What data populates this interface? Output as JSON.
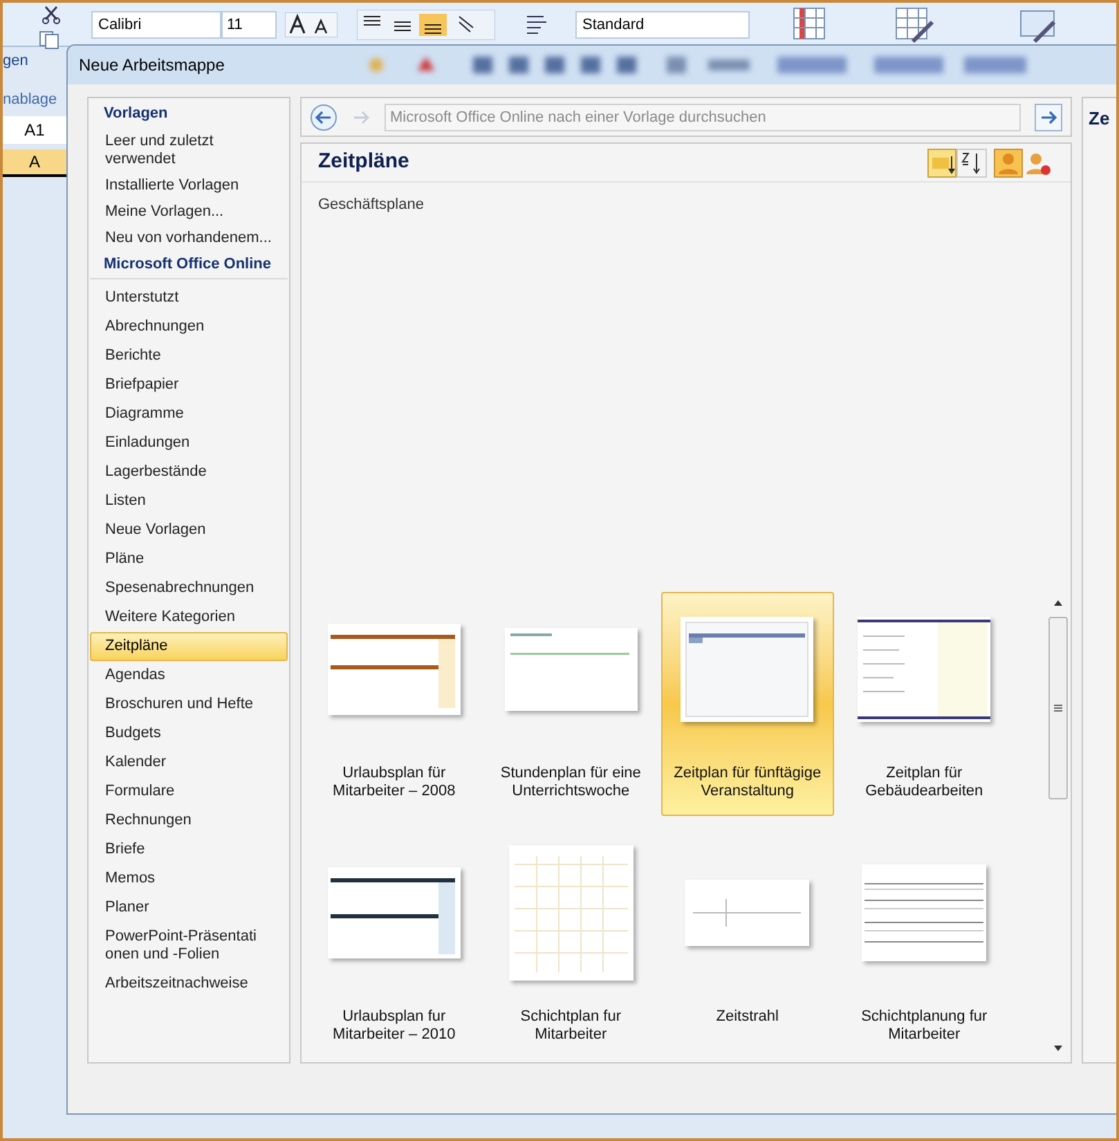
{
  "ribbon": {
    "left_labels": [
      "gen",
      "nablage"
    ],
    "name_box": "A1",
    "column_header": "A",
    "font": "Calibri",
    "font_size": "11",
    "number_format": "Standard"
  },
  "window": {
    "title": "Neue Arbeitsmappe"
  },
  "sidebar": {
    "sections": [
      {
        "heading": "Vorlagen",
        "items": [
          {
            "label": "Leer und zuletzt verwendet",
            "selected": false
          },
          {
            "label": "Installierte Vorlagen",
            "selected": false
          },
          {
            "label": "Meine Vorlagen...",
            "selected": false
          },
          {
            "label": "Neu von vorhandenem...",
            "selected": false
          }
        ]
      },
      {
        "heading": "Microsoft Office Online",
        "items": [
          {
            "label": "Unterstutzt",
            "selected": false
          },
          {
            "label": "Abrechnungen",
            "selected": false
          },
          {
            "label": "Berichte",
            "selected": false
          },
          {
            "label": "Briefpapier",
            "selected": false
          },
          {
            "label": "Diagramme",
            "selected": false
          },
          {
            "label": "Einladungen",
            "selected": false
          },
          {
            "label": "Lagerbestände",
            "selected": false
          },
          {
            "label": "Listen",
            "selected": false
          },
          {
            "label": "Neue Vorlagen",
            "selected": false
          },
          {
            "label": "Pläne",
            "selected": false
          },
          {
            "label": "Spesenabrechnungen",
            "selected": false
          },
          {
            "label": "Weitere Kategorien",
            "selected": false
          },
          {
            "label": "Zeitpläne",
            "selected": true
          },
          {
            "label": "Agendas",
            "selected": false
          },
          {
            "label": "Broschuren und Hefte",
            "selected": false
          },
          {
            "label": "Budgets",
            "selected": false
          },
          {
            "label": "Kalender",
            "selected": false
          },
          {
            "label": "Formulare",
            "selected": false
          },
          {
            "label": "Rechnungen",
            "selected": false
          },
          {
            "label": "Briefe",
            "selected": false
          },
          {
            "label": "Memos",
            "selected": false
          },
          {
            "label": "Planer",
            "selected": false
          },
          {
            "label": "PowerPoint-Präsentati onen und -Folien",
            "selected": false
          },
          {
            "label": "Arbeitszeitnachweise",
            "selected": false
          }
        ]
      }
    ]
  },
  "search": {
    "placeholder": "Microsoft Office Online nach einer Vorlage durchsuchen"
  },
  "content": {
    "title": "Zeitpläne",
    "subtitle": "Geschäftsplane",
    "templates": [
      {
        "label": "Urlaubsplan für Mitarbeiter – 2008",
        "kind": "bands",
        "selected": false
      },
      {
        "label": "Stundenplan für eine Unterrichtswoche",
        "kind": "plain",
        "selected": false
      },
      {
        "label": "Zeitplan für fünftägige Veranstaltung",
        "kind": "header",
        "selected": true
      },
      {
        "label": "Zeitplan für Gebäudearbeiten",
        "kind": "list",
        "selected": false
      },
      {
        "label": "Urlaubsplan fur Mitarbeiter – 2010",
        "kind": "bands-dark",
        "selected": false
      },
      {
        "label": "Schichtplan fur Mitarbeiter",
        "kind": "grid",
        "selected": false
      },
      {
        "label": "Zeitstrahl",
        "kind": "timeline",
        "selected": false
      },
      {
        "label": "Schichtplanung fur Mitarbeiter",
        "kind": "table",
        "selected": false
      }
    ]
  },
  "preview": {
    "title": "Ze"
  }
}
